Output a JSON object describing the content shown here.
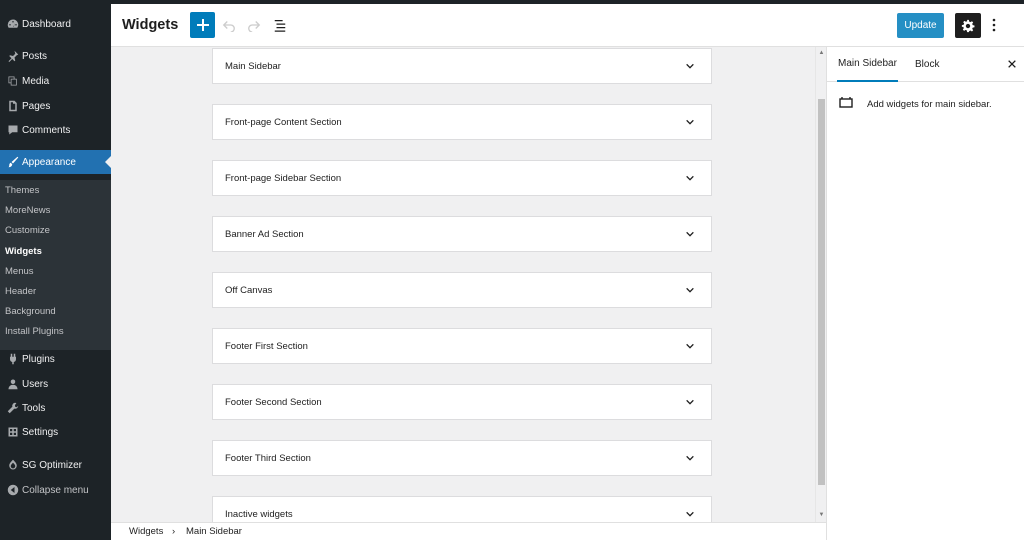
{
  "admin_menu": {
    "items": [
      {
        "label": "Dashboard"
      },
      {
        "label": "Posts"
      },
      {
        "label": "Media"
      },
      {
        "label": "Pages"
      },
      {
        "label": "Comments"
      },
      {
        "label": "Appearance"
      },
      {
        "label": "Plugins"
      },
      {
        "label": "Users"
      },
      {
        "label": "Tools"
      },
      {
        "label": "Settings"
      },
      {
        "label": "SG Optimizer"
      },
      {
        "label": "Collapse menu"
      }
    ],
    "submenu": [
      {
        "label": "Themes"
      },
      {
        "label": "MoreNews"
      },
      {
        "label": "Customize"
      },
      {
        "label": "Widgets"
      },
      {
        "label": "Menus"
      },
      {
        "label": "Header"
      },
      {
        "label": "Background"
      },
      {
        "label": "Install Plugins"
      }
    ],
    "current_item": "Appearance",
    "current_subitem": "Widgets"
  },
  "header": {
    "title": "Widgets",
    "update_label": "Update"
  },
  "widget_areas": [
    {
      "title": "Main Sidebar"
    },
    {
      "title": "Front-page Content Section"
    },
    {
      "title": "Front-page Sidebar Section"
    },
    {
      "title": "Banner Ad Section"
    },
    {
      "title": "Off Canvas"
    },
    {
      "title": "Footer First Section"
    },
    {
      "title": "Footer Second Section"
    },
    {
      "title": "Footer Third Section"
    },
    {
      "title": "Inactive widgets"
    }
  ],
  "panel": {
    "tabs": [
      {
        "label": "Main Sidebar",
        "active": true
      },
      {
        "label": "Block",
        "active": false
      }
    ],
    "description": "Add widgets for main sidebar."
  },
  "breadcrumb": {
    "root": "Widgets",
    "separator": "›",
    "current": "Main Sidebar"
  },
  "colors": {
    "accent": "#2271b1",
    "primary_button": "#007cba",
    "sidebar_bg": "#1d2327",
    "submenu_bg": "#2c3338"
  },
  "icons": {
    "dashboard": "dashboard-icon",
    "posts": "pin-icon",
    "media": "media-icon",
    "pages": "pages-icon",
    "comments": "comment-icon",
    "appearance": "brush-icon",
    "plugins": "plug-icon",
    "users": "user-icon",
    "tools": "wrench-icon",
    "settings": "settings-icon",
    "sg_optimizer": "sg-icon",
    "collapse": "collapse-icon"
  }
}
